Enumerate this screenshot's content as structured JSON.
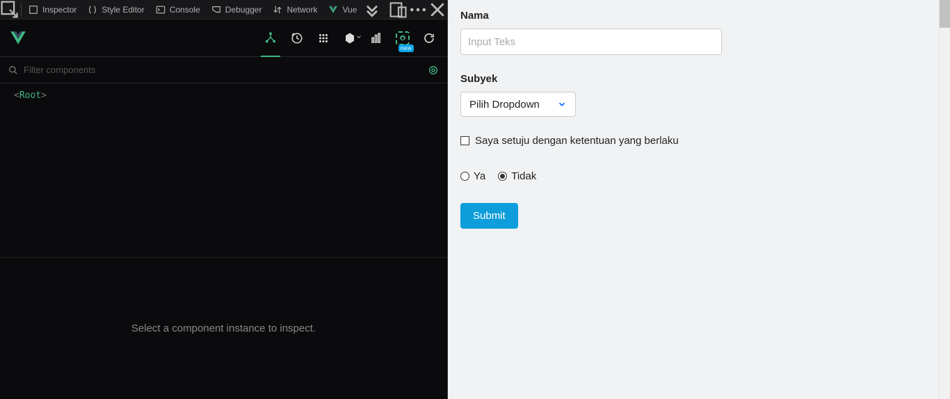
{
  "devtools": {
    "tabs": {
      "inspector": "Inspector",
      "style_editor": "Style Editor",
      "console": "Console",
      "debugger": "Debugger",
      "network": "Network",
      "vue": "Vue"
    },
    "vue_panel": {
      "filter_placeholder": "Filter components",
      "badge_new": "new",
      "root_component": "Root",
      "inspect_hint": "Select a component instance to inspect."
    }
  },
  "form": {
    "nama": {
      "label": "Nama",
      "placeholder": "Input Teks"
    },
    "subyek": {
      "label": "Subyek",
      "selected": "Pilih Dropdown"
    },
    "checkbox": {
      "label": "Saya setuju dengan ketentuan yang berlaku",
      "checked": false
    },
    "radio": {
      "options": {
        "ya": "Ya",
        "tidak": "Tidak"
      },
      "selected": "tidak"
    },
    "submit_label": "Submit"
  }
}
